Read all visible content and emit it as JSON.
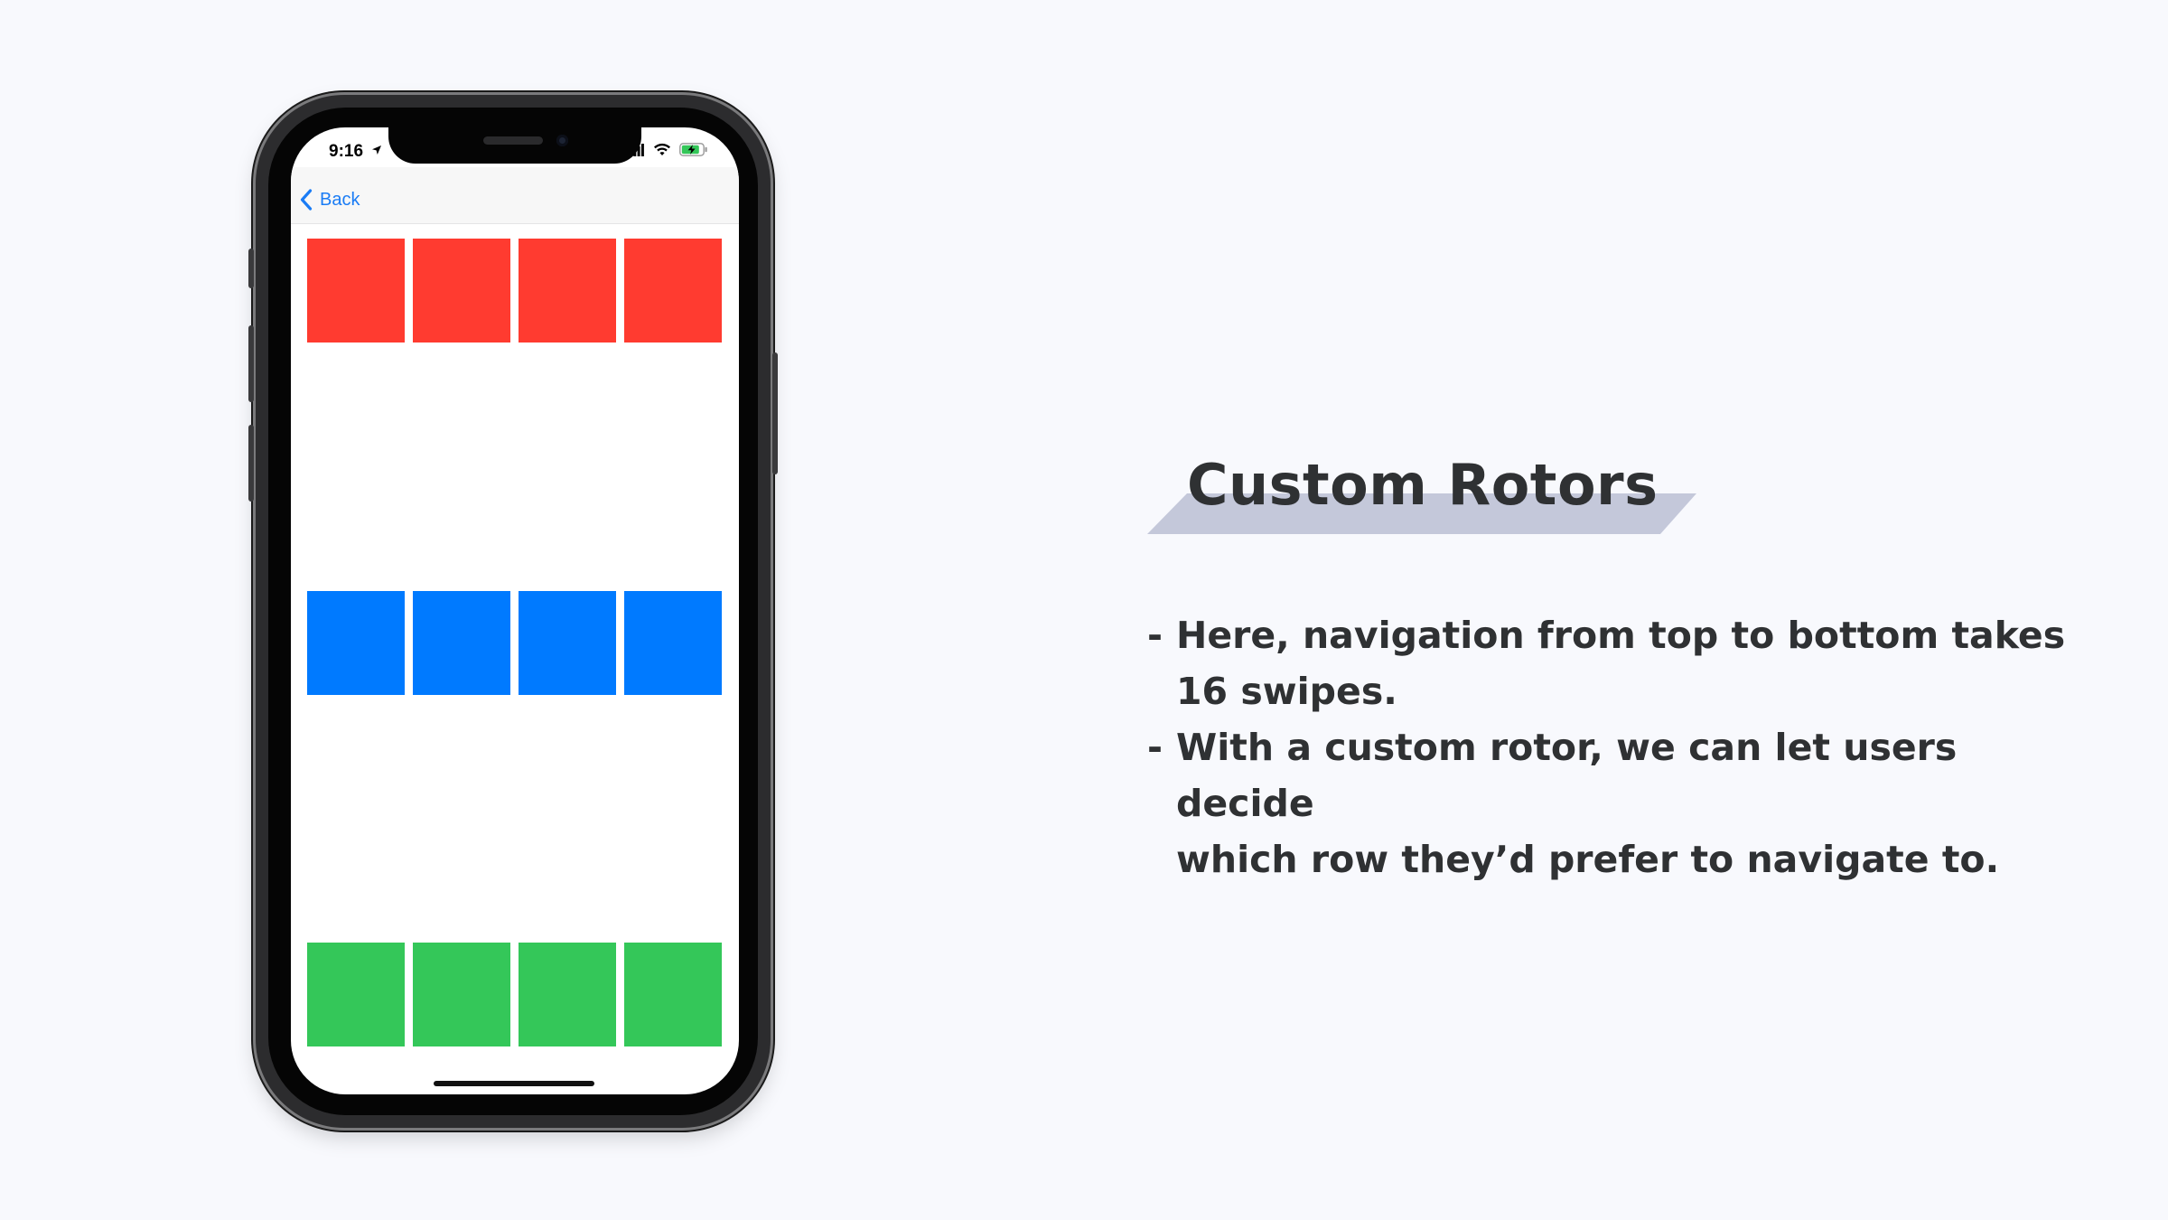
{
  "slide": {
    "background": "#f8f9fd",
    "title": "Custom Rotors",
    "title_highlight_color": "#c4c8da",
    "text_color": "#2f3133",
    "bullets": [
      {
        "dash": "-",
        "lines": [
          "Here, navigation from top to bottom takes",
          "16 swipes."
        ]
      },
      {
        "dash": "-",
        "lines": [
          "With a custom rotor, we can let users decide",
          "which row they’d prefer to navigate to."
        ]
      }
    ]
  },
  "phone": {
    "status_bar": {
      "time": "9:16",
      "icons": [
        "location-arrow-icon",
        "cellular-signal-icon",
        "wifi-icon",
        "battery-charging-icon"
      ]
    },
    "nav_bar": {
      "back_label": "Back",
      "back_icon": "chevron-left-icon",
      "tint_color": "#1a7cf5"
    },
    "rows": [
      {
        "name": "red",
        "color": "#ff3b30",
        "tiles": 4
      },
      {
        "name": "blue",
        "color": "#007aff",
        "tiles": 4
      },
      {
        "name": "green",
        "color": "#34c759",
        "tiles": 4
      }
    ]
  }
}
